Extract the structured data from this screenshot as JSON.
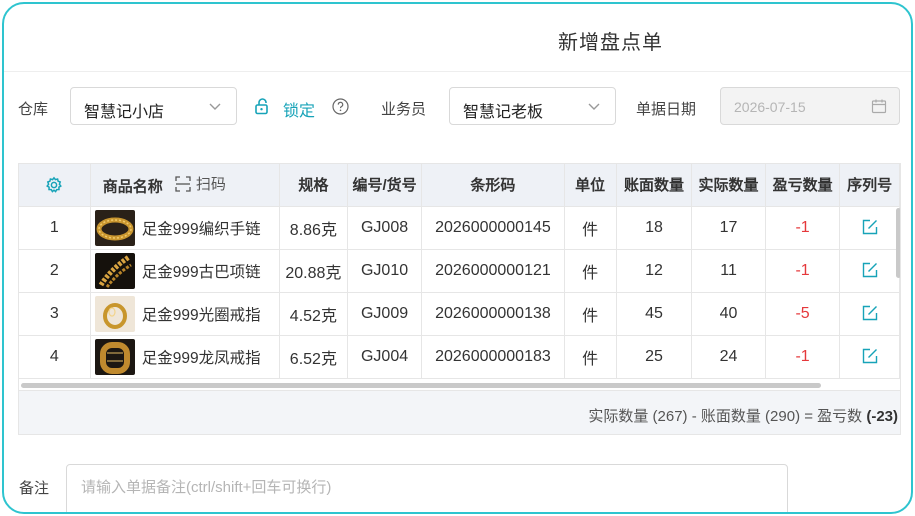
{
  "title": "新增盘点单",
  "form": {
    "warehouse_label": "仓库",
    "warehouse_value": "智慧记小店",
    "lock_label": "锁定",
    "salesperson_label": "业务员",
    "salesperson_value": "智慧记老板",
    "date_label": "单据日期",
    "date_value": "2026-07-15"
  },
  "table": {
    "columns": {
      "name": "商品名称",
      "scan": "扫码",
      "spec": "规格",
      "code": "编号/货号",
      "barcode": "条形码",
      "unit": "单位",
      "book_qty": "账面数量",
      "actual_qty": "实际数量",
      "diff_qty": "盈亏数量",
      "serial": "序列号"
    },
    "rows": [
      {
        "index": "1",
        "name": "足金999编织手链",
        "spec": "8.86克",
        "code": "GJ008",
        "barcode": "2026000000145",
        "unit": "件",
        "book_qty": "18",
        "actual_qty": "17",
        "diff_qty": "-1",
        "thumb": "bracelet-woven"
      },
      {
        "index": "2",
        "name": "足金999古巴项链",
        "spec": "20.88克",
        "code": "GJ010",
        "barcode": "2026000000121",
        "unit": "件",
        "book_qty": "12",
        "actual_qty": "11",
        "diff_qty": "-1",
        "thumb": "necklace-cuban"
      },
      {
        "index": "3",
        "name": "足金999光圈戒指",
        "spec": "4.52克",
        "code": "GJ009",
        "barcode": "2026000000138",
        "unit": "件",
        "book_qty": "45",
        "actual_qty": "40",
        "diff_qty": "-5",
        "thumb": "ring-plain"
      },
      {
        "index": "4",
        "name": "足金999龙凤戒指",
        "spec": "6.52克",
        "code": "GJ004",
        "barcode": "2026000000183",
        "unit": "件",
        "book_qty": "25",
        "actual_qty": "24",
        "diff_qty": "-1",
        "thumb": "ring-dragon"
      }
    ],
    "summary_text": "实际数量 (267) - 账面数量 (290) = 盈亏数 ",
    "summary_total": "(-23)"
  },
  "remark": {
    "label": "备注",
    "placeholder": "请输入单据备注(ctrl/shift+回车可换行)"
  },
  "colors": {
    "accent": "#17a3b8",
    "frame": "#2ec4cf",
    "negative": "#e5383b"
  }
}
